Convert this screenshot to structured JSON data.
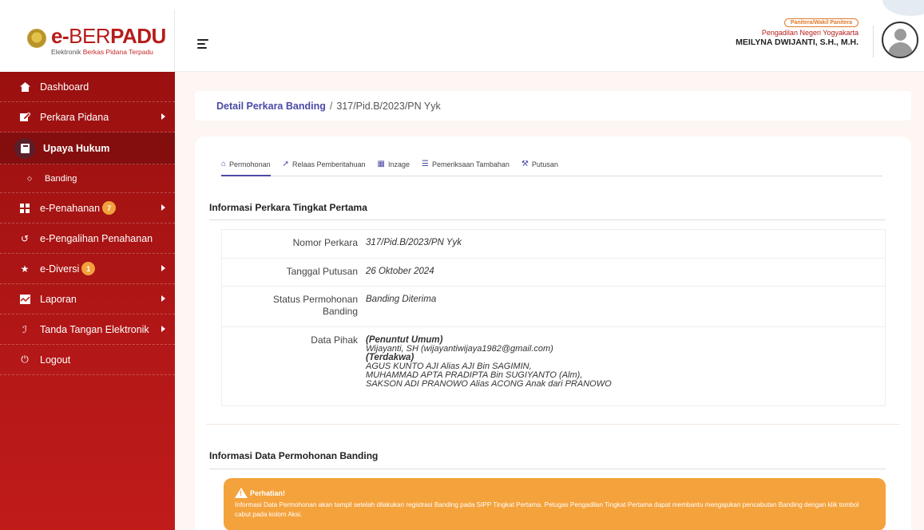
{
  "brand": {
    "title_prefix": "e-",
    "title_thin": "BER",
    "title_bold": "PADU",
    "subtitle_prefix": "Elektronik ",
    "subtitle_red": "Berkas Pidana Terpadu"
  },
  "user": {
    "role": "Panitera/Wakil Panitera",
    "court": "Pengadilan Negeri Yogyakarta",
    "name": "MEILYNA DWIJANTI, S.H., M.H."
  },
  "sidebar": {
    "items": [
      {
        "label": "Dashboard",
        "icon": "home-icon"
      },
      {
        "label": "Perkara Pidana",
        "icon": "edit-icon"
      },
      {
        "label": "Upaya Hukum",
        "icon": "book-icon"
      },
      {
        "label": "Banding",
        "icon": "diamond-icon"
      },
      {
        "label": "e-Penahanan",
        "icon": "grid-icon",
        "badge": "7"
      },
      {
        "label": "e-Pengalihan Penahanan",
        "icon": "history-icon"
      },
      {
        "label": "e-Diversi",
        "icon": "star-icon",
        "badge": "1"
      },
      {
        "label": "Laporan",
        "icon": "chart-icon"
      },
      {
        "label": "Tanda Tangan Elektronik",
        "icon": "signature-icon"
      },
      {
        "label": "Logout",
        "icon": "power-icon"
      }
    ]
  },
  "breadcrumb": {
    "link": "Detail Perkara Banding",
    "separator": "/",
    "current": "317/Pid.B/2023/PN Yyk"
  },
  "tabs": [
    {
      "label": "Permohonan",
      "icon": "home-icon"
    },
    {
      "label": "Relaas Pemberitahuan",
      "icon": "send-icon"
    },
    {
      "label": "Inzage",
      "icon": "calendar-icon"
    },
    {
      "label": "Pemeriksaan Tambahan",
      "icon": "document-icon"
    },
    {
      "label": "Putusan",
      "icon": "gavel-icon"
    }
  ],
  "section1": {
    "title": "Informasi Perkara Tingkat Pertama",
    "rows": {
      "nomor_label": "Nomor Perkara",
      "nomor_value": "317/Pid.B/2023/PN Yyk",
      "tanggal_label": "Tanggal Putusan",
      "tanggal_value": "26 Oktober 2024",
      "status_label_1": "Status Permohonan",
      "status_label_2": "Banding",
      "status_value": "Banding Diterima",
      "pihak_label": "Data Pihak",
      "pihak_lines": [
        "(Penuntut Umum)",
        "Wijayanti, SH (wijayantiwijaya1982@gmail.com)",
        "(Terdakwa)",
        "AGUS KUNTO AJI Alias AJI Bin SAGIMIN,",
        "MUHAMMAD APTA PRADIPTA Bin SUGIYANTO (Alm),",
        "SAKSON ADI PRANOWO Alias ACONG Anak dari PRANOWO"
      ]
    }
  },
  "section2": {
    "title": "Informasi Data Permohonan Banding",
    "alert_title": "Perhatian!",
    "alert_text": "Informasi Data Permohonan akan tampil setelah dilakukan registrasi Banding pada SIPP Tingkat Pertama. Petugas Pengadilan Tingkat Pertama dapat membantu mengajukan pencabutan Banding dengan klik tombol cabut pada kolom Aksi."
  }
}
